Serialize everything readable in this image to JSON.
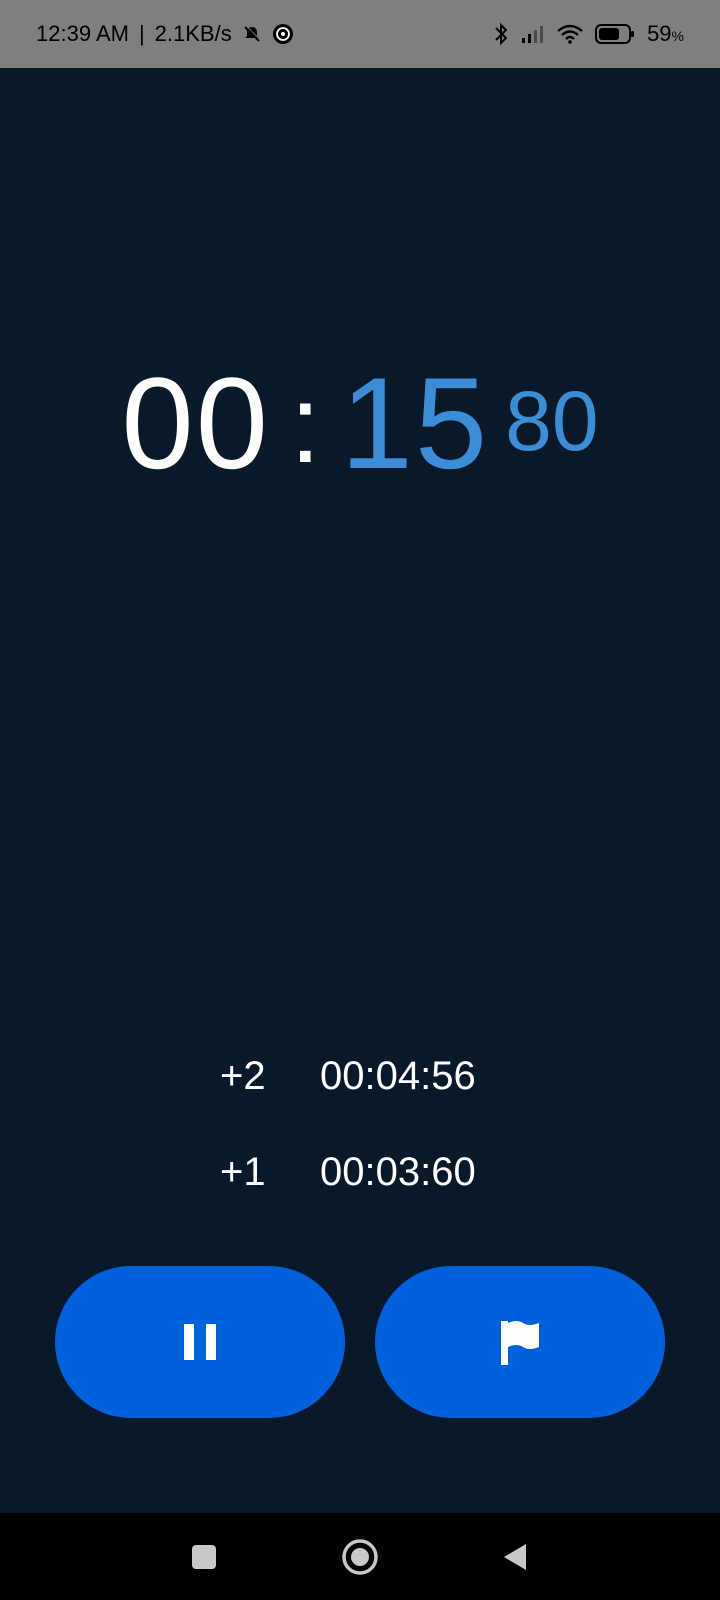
{
  "status_bar": {
    "time": "12:39 AM",
    "separator": "|",
    "speed": "2.1KB/s",
    "battery_pct": "59",
    "battery_unit": "%",
    "icons": [
      "mute-bell-icon",
      "app-notification-icon",
      "bluetooth-icon",
      "signal-icon",
      "wifi-icon",
      "battery-icon"
    ]
  },
  "stopwatch": {
    "minutes": "00",
    "colon": ":",
    "seconds": "15",
    "centiseconds": "80"
  },
  "laps": [
    {
      "index": "+2",
      "time": "00:04:56"
    },
    {
      "index": "+1",
      "time": "00:03:60"
    }
  ],
  "controls": {
    "pause_icon": "pause-icon",
    "lap_icon": "flag-icon",
    "button_color": "#0061dc"
  },
  "colors": {
    "background": "#0a1929",
    "accent": "#3b8ed6",
    "status_bar": "#7f7f7f"
  },
  "navigation": {
    "icons": [
      "recents-square-icon",
      "home-circle-icon",
      "back-triangle-icon"
    ]
  }
}
